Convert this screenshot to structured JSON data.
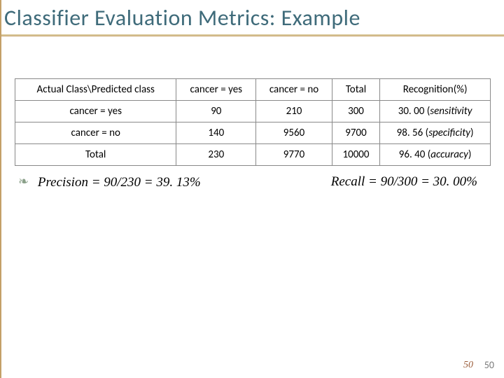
{
  "title": "Classifier Evaluation Metrics: Example",
  "table": {
    "header": [
      "Actual Class\\Predicted class",
      "cancer = yes",
      "cancer = no",
      "Total",
      "Recognition(%)"
    ],
    "rows": [
      {
        "label": "cancer = yes",
        "yes": "90",
        "no": "210",
        "total": "300",
        "rec_val": "30. 00",
        "rec_tag": "sensitivity"
      },
      {
        "label": "cancer = no",
        "yes": "140",
        "no": "9560",
        "total": "9700",
        "rec_val": "98. 56",
        "rec_tag": "specificity"
      },
      {
        "label": "Total",
        "yes": "230",
        "no": "9770",
        "total": "10000",
        "rec_val": "96. 40",
        "rec_tag": "accuracy"
      }
    ]
  },
  "metrics": {
    "precision": "Precision = 90/230 = 39. 13%",
    "recall": "Recall = 90/300 = 30. 00%"
  },
  "page": {
    "script": "50",
    "plain": "50"
  },
  "chart_data": {
    "type": "table",
    "title": "Confusion matrix with recognition rates",
    "columns": [
      "Actual Class \\ Predicted class",
      "cancer = yes",
      "cancer = no",
      "Total",
      "Recognition(%)"
    ],
    "rows": [
      [
        "cancer = yes",
        90,
        210,
        300,
        30.0
      ],
      [
        "cancer = no",
        140,
        9560,
        9700,
        98.56
      ],
      [
        "Total",
        230,
        9770,
        10000,
        96.4
      ]
    ],
    "derived": {
      "precision_pct": 39.13,
      "recall_pct": 30.0
    }
  }
}
